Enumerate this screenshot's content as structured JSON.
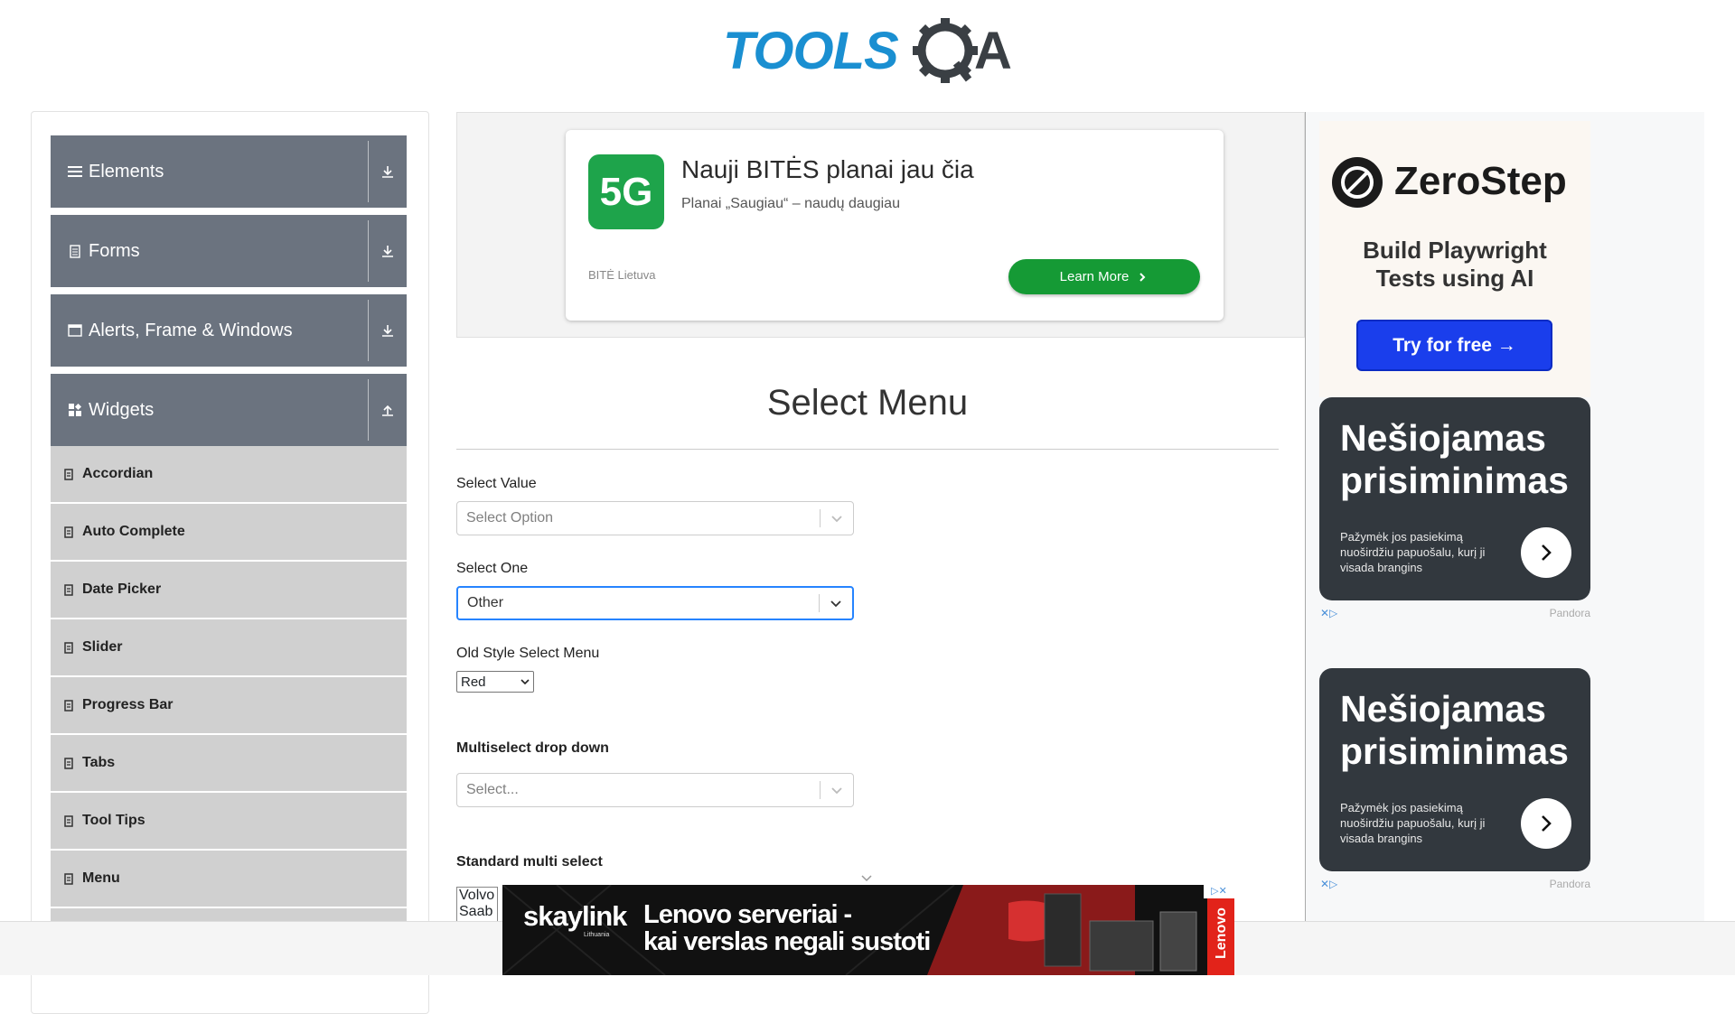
{
  "header": {
    "logo_text": "TOOLSQA"
  },
  "sidebar": {
    "groups": [
      {
        "label": "Elements",
        "icon": "hamburger-icon",
        "arrow": "download-arrow-icon"
      },
      {
        "label": "Forms",
        "icon": "document-icon",
        "arrow": "download-arrow-icon"
      },
      {
        "label": "Alerts, Frame & Windows",
        "icon": "window-icon",
        "arrow": "download-arrow-icon"
      },
      {
        "label": "Widgets",
        "icon": "widgets-icon",
        "arrow": "upload-arrow-icon"
      }
    ],
    "widget_items": [
      "Accordian",
      "Auto Complete",
      "Date Picker",
      "Slider",
      "Progress Bar",
      "Tabs",
      "Tool Tips",
      "Menu"
    ]
  },
  "top_ad": {
    "badge": "5G",
    "title": "Nauji BITĖS planai jau čia",
    "subtitle": "Planai „Saugiau“ – naudų daugiau",
    "brand": "BITĖ Lietuva",
    "cta": "Learn More"
  },
  "main": {
    "title": "Select Menu",
    "select_value": {
      "label": "Select Value",
      "placeholder": "Select Option"
    },
    "select_one": {
      "label": "Select One",
      "value": "Other"
    },
    "old_style": {
      "label": "Old Style Select Menu",
      "value": "Red"
    },
    "multiselect": {
      "label": "Multiselect drop down",
      "placeholder": "Select..."
    },
    "standard_multi": {
      "label": "Standard multi select",
      "options": [
        "Volvo",
        "Saab"
      ]
    }
  },
  "right_ads": {
    "zerostep": {
      "name": "ZeroStep",
      "tagline_1": "Build Playwright",
      "tagline_2": "Tests using AI",
      "cta": "Try for free →"
    },
    "pandora_cards": [
      {
        "title": "Nešiojamas prisiminimas",
        "text": "Pažymėk jos pasiekimą nuoširdžiu papuošalu, kurį ji visada brangins",
        "footer": "Pandora"
      },
      {
        "title": "Nešiojamas prisiminimas",
        "text": "Pažymėk jos pasiekimą nuoširdžiu papuošalu, kurį ji visada brangins",
        "footer": "Pandora"
      }
    ]
  },
  "bottom_ad": {
    "brand": "skaylink",
    "brand_sub": "Lithuania",
    "line1": "Lenovo serveriai -",
    "line2": "kai verslas negali sustoti",
    "side_brand": "Lenovo"
  },
  "colors": {
    "sidebar_group": "#6b737f",
    "sidebar_item": "#d0d0d0",
    "focus_border": "#2684ff",
    "bite_green": "#1ea44b",
    "zerostep_blue": "#1a3eec",
    "pandora_card": "#32383e"
  }
}
